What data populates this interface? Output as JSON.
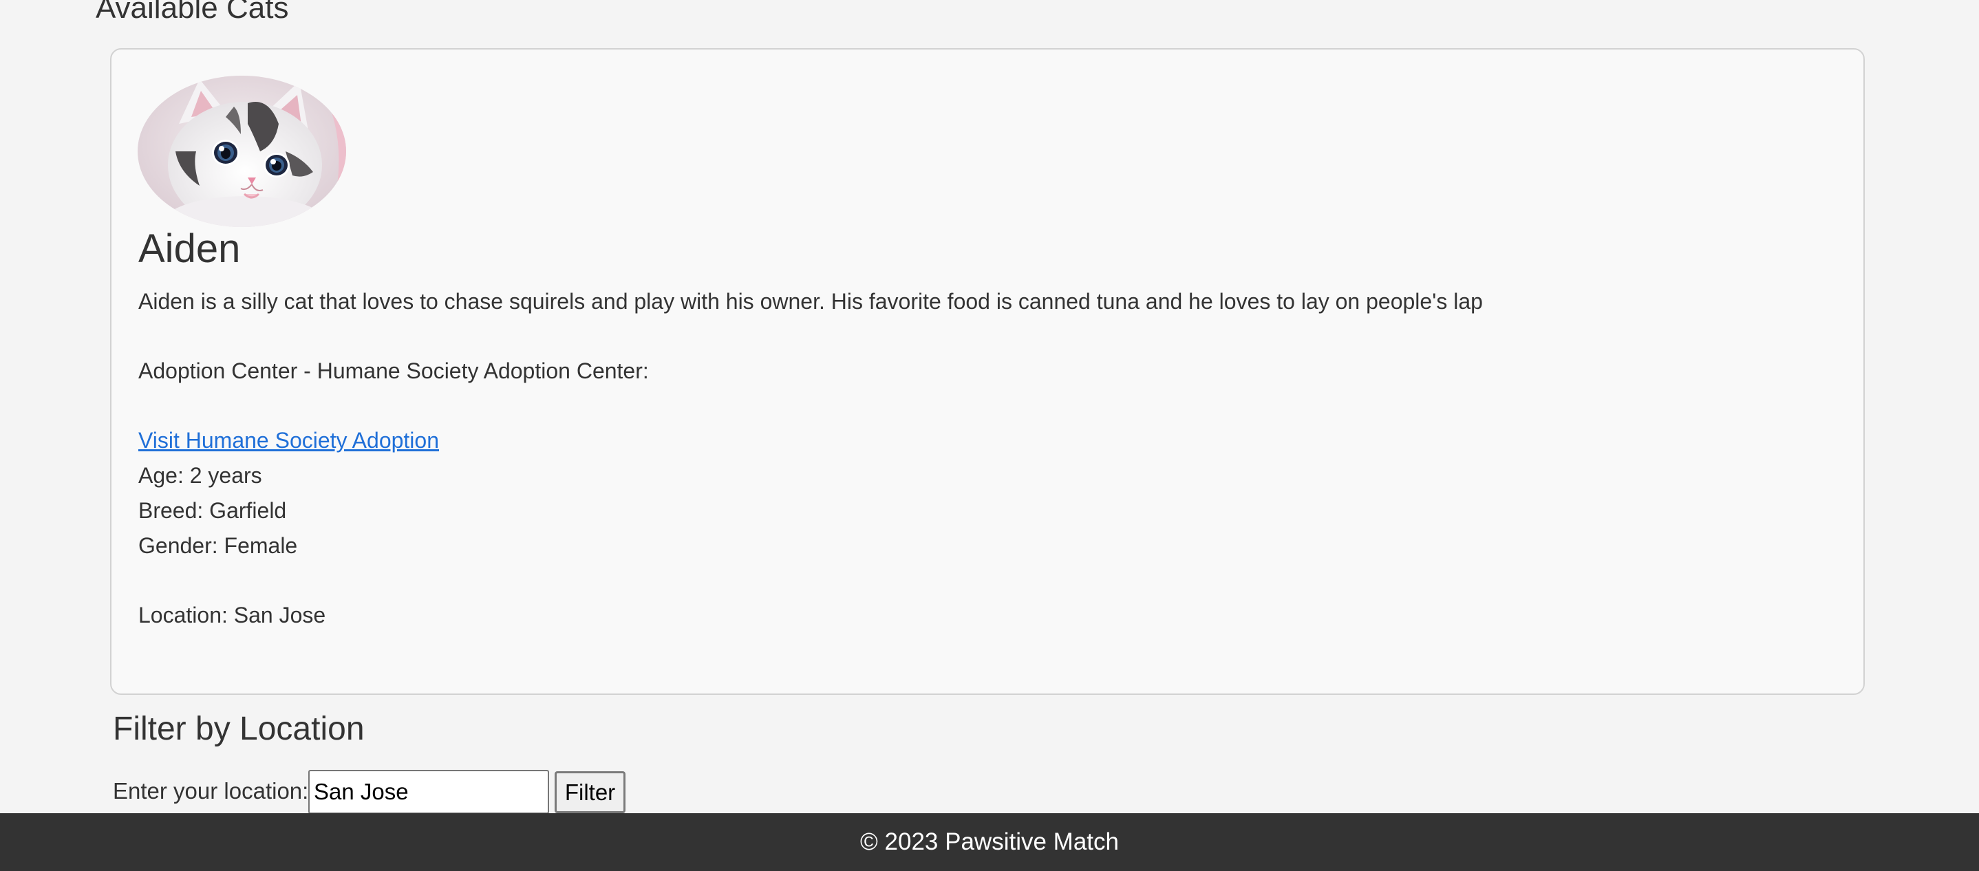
{
  "page": {
    "heading": "Available Cats"
  },
  "cat": {
    "name": "Aiden",
    "description": "Aiden is a silly cat that loves to chase squirels and play with his owner. His favorite food is canned tuna and he loves to lay on people's lap",
    "adoption_center": "Adoption Center - Humane Society Adoption Center:",
    "link_text": "Visit Humane Society Adoption",
    "age": "Age: 2 years",
    "breed": "Breed: Garfield",
    "gender": "Gender: Female",
    "location": "Location: San Jose",
    "photo_icon": "cat-photo-icon"
  },
  "filter": {
    "heading": "Filter by Location",
    "label": "Enter your location:",
    "input_value": "San Jose",
    "button_label": "Filter"
  },
  "footer": {
    "text": "© 2023 Pawsitive Match"
  },
  "colors": {
    "background": "#f4f4f4",
    "card_background": "#f9f9f9",
    "link": "#1f6fd8",
    "footer_background": "#333333",
    "text": "#333333"
  }
}
